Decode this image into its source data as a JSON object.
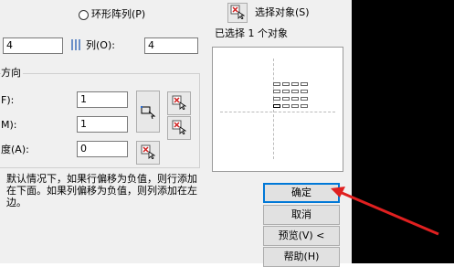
{
  "dialog": {
    "radio_polar": "环形阵列(P)",
    "select_objects_label": "选择对象(S)",
    "selected_count_text": "已选择 1 个对象",
    "rows_value": "4",
    "columns_label": "列(O):",
    "columns_value": "4",
    "offset_group_title": "方向",
    "row_offset_label": "F):",
    "row_offset_value": "1",
    "col_offset_label": "M):",
    "col_offset_value": "1",
    "angle_label": "度(A):",
    "angle_value": "0",
    "hint_text": "默认情况下，如果行偏移为负值，则行添加在下面。如果列偏移为负值，则列添加在左边。",
    "buttons": {
      "ok": "确定",
      "cancel": "取消",
      "preview": "预览(V) <",
      "help": "帮助(H)"
    },
    "preview_grid": {
      "rows": 4,
      "columns": 4
    }
  },
  "colors": {
    "arrow": "#e02020",
    "default_button_border": "#0078d7",
    "backdrop": "#000000"
  }
}
